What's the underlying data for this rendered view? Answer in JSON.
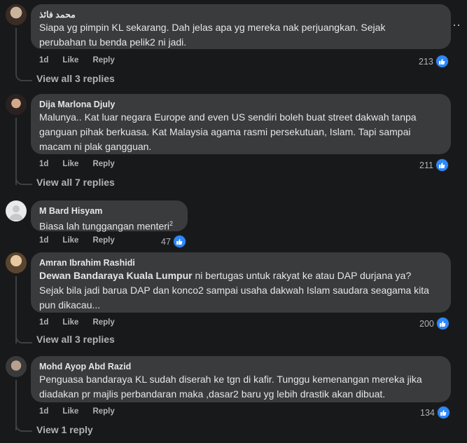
{
  "comments": [
    {
      "author": "محمد فائذ",
      "text_lines": [
        "Siapa yg pimpin KL sekarang. Dah jelas apa yg mereka nak perjuangkan. Sejak",
        "perubahan tu benda pelik2 ni jadi."
      ],
      "time": "1d",
      "like": "Like",
      "reply": "Reply",
      "reactions": "213",
      "view_replies": "View all 3 replies"
    },
    {
      "author": "Dija Marlona Djuly",
      "text_lines": [
        "Malunya.. Kat luar negara Europe and even US sendiri boleh buat street dakwah tanpa",
        "ganguan pihak berkuasa. Kat Malaysia agama rasmi persekutuan, Islam. Tapi sampai",
        "macam ni plak gangguan."
      ],
      "time": "1d",
      "like": "Like",
      "reply": "Reply",
      "reactions": "211",
      "view_replies": "View all 7 replies"
    },
    {
      "author": "M Bard Hisyam",
      "text": "Biasa lah tunggangan menteri",
      "superscript": "2",
      "time": "1d",
      "like": "Like",
      "reply": "Reply",
      "reactions": "47"
    },
    {
      "author": "Amran Ibrahim Rashidi",
      "link": "Dewan Bandaraya Kuala Lumpur",
      "text_line1_rest": " ni bertugas untuk rakyat ke atau DAP durjana ya?",
      "text_lines_more": [
        "Sejak bila jadi barua DAP dan konco2 sampai usaha dakwah Islam saudara seagama kita",
        "pun dikacau..."
      ],
      "time": "1d",
      "like": "Like",
      "reply": "Reply",
      "reactions": "200",
      "view_replies": "View all 3 replies"
    },
    {
      "author": "Mohd Ayop Abd Razid",
      "text_lines": [
        "Penguasa bandaraya KL sudah diserah ke tgn di kafir. Tunggu kemenangan mereka jika",
        "diadakan pr majlis perbandaran maka ,dasar2 baru yg lebih drastik akan dibuat."
      ],
      "time": "1d",
      "like": "Like",
      "reply": "Reply",
      "reactions": "134",
      "view_replies": "View 1 reply"
    }
  ],
  "colors": {
    "background": "#18191a",
    "bubble": "#3a3b3c",
    "like_blue": "#2d88ff",
    "muted": "#b0b3b8"
  },
  "icons": {
    "more": "ellipsis-icon",
    "reaction": "like-thumb-icon"
  }
}
